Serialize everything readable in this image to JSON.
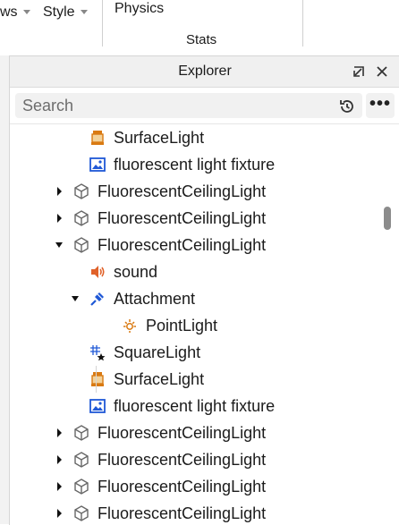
{
  "ribbon": {
    "items": [
      {
        "label": "ws",
        "caret": true
      },
      {
        "label": "Style",
        "caret": true
      },
      {
        "label": "Physics",
        "caret": false
      }
    ],
    "group_label": "Stats"
  },
  "explorer": {
    "title": "Explorer",
    "search_placeholder": "Search",
    "more_label": "•••",
    "rows": [
      {
        "label": "SurfaceLight",
        "icon": "surface-light-icon",
        "expand": "none"
      },
      {
        "label": "fluorescent light fixture",
        "icon": "image-icon",
        "expand": "none"
      },
      {
        "label": "FluorescentCeilingLight",
        "icon": "model-icon",
        "expand": "collapsed"
      },
      {
        "label": "FluorescentCeilingLight",
        "icon": "model-icon",
        "expand": "collapsed"
      },
      {
        "label": "FluorescentCeilingLight",
        "icon": "model-icon",
        "expand": "expanded"
      },
      {
        "label": "sound",
        "icon": "sound-icon",
        "expand": "none"
      },
      {
        "label": "Attachment",
        "icon": "attachment-icon",
        "expand": "expanded"
      },
      {
        "label": "PointLight",
        "icon": "point-light-icon",
        "expand": "none"
      },
      {
        "label": "SquareLight",
        "icon": "square-light-icon",
        "expand": "none"
      },
      {
        "label": "SurfaceLight",
        "icon": "surface-light-icon",
        "expand": "none"
      },
      {
        "label": "fluorescent light fixture",
        "icon": "image-icon",
        "expand": "none"
      },
      {
        "label": "FluorescentCeilingLight",
        "icon": "model-icon",
        "expand": "collapsed"
      },
      {
        "label": "FluorescentCeilingLight",
        "icon": "model-icon",
        "expand": "collapsed"
      },
      {
        "label": "FluorescentCeilingLight",
        "icon": "model-icon",
        "expand": "collapsed"
      },
      {
        "label": "FluorescentCeilingLight",
        "icon": "model-icon",
        "expand": "collapsed"
      }
    ]
  },
  "colors": {
    "accent_blue": "#1f58d6",
    "surface_light_orange": "#d97a12",
    "sound_orange": "#e0622a"
  }
}
